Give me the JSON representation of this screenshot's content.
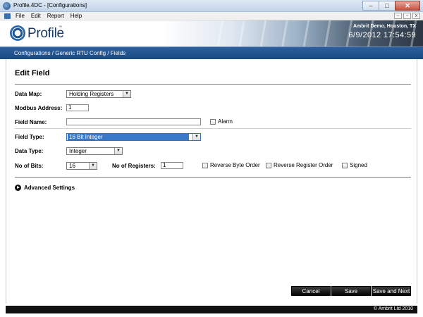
{
  "window": {
    "title": "Profile.4DC - [Configurations]",
    "buttons": [
      "–",
      "□",
      "✕"
    ]
  },
  "menu": {
    "items": [
      "File",
      "Edit",
      "Report",
      "Help"
    ],
    "mdi_buttons": [
      "–",
      "▫",
      "x"
    ]
  },
  "banner": {
    "logo": "Profile",
    "trademark": "™",
    "site": "Ambrit Demo, Houston, TX",
    "datetime": "6/9/2012   17:54:59"
  },
  "breadcrumb": "Configurations / Generic RTU Config / Fields",
  "form": {
    "heading": "Edit Field",
    "data_map": {
      "label": "Data Map:",
      "value": "Holding Registers"
    },
    "modbus_address": {
      "label": "Modbus Address:",
      "value": "1"
    },
    "field_name": {
      "label": "Field Name:",
      "value": "",
      "alarm_label": "Alarm"
    },
    "field_type": {
      "label": "Field Type:",
      "value": "16 Bit Integer"
    },
    "data_type": {
      "label": "Data Type:",
      "value": "Integer"
    },
    "no_of_bits": {
      "label": "No of Bits:",
      "value": "16"
    },
    "no_of_registers": {
      "label": "No of Registers:",
      "value": "1"
    },
    "reverse_byte_order": "Reverse Byte Order",
    "reverse_register_order": "Reverse Register Order",
    "signed": "Signed",
    "advanced_settings": "Advanced Settings"
  },
  "actions": {
    "cancel": "Cancel",
    "save": "Save",
    "save_next": "Save and Next"
  },
  "footer": {
    "copyright": "© Ambrit Ltd 2010"
  },
  "colors": {
    "nav_blue": "#1b4a82",
    "selection_blue": "#3a78c8",
    "button_black": "#050505"
  }
}
